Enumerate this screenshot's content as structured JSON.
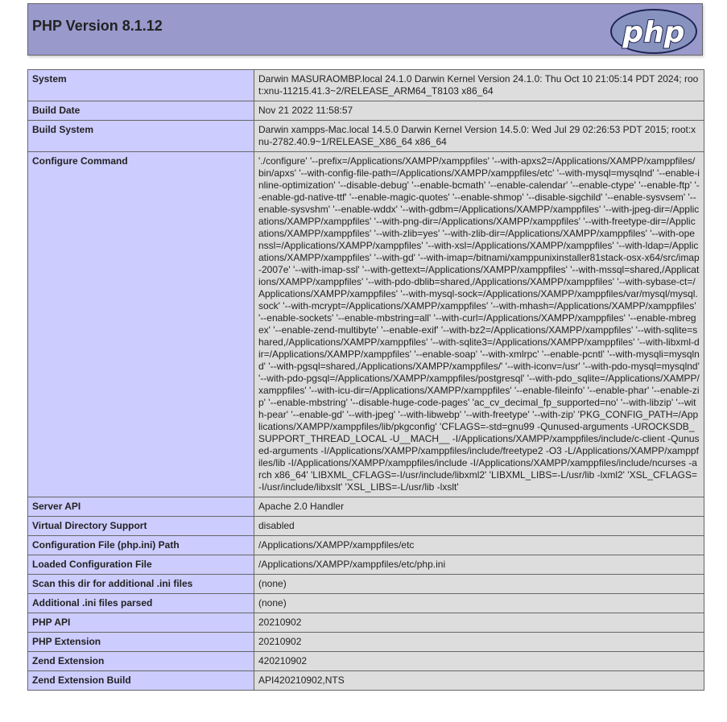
{
  "header": {
    "title": "PHP Version 8.1.12",
    "logo_text": "php",
    "logo_color": "#8892bf"
  },
  "info_rows": [
    {
      "key": "System",
      "value": "Darwin MASURAOMBP.local 24.1.0 Darwin Kernel Version 24.1.0: Thu Oct 10 21:05:14 PDT 2024; root:xnu-11215.41.3~2/RELEASE_ARM64_T8103 x86_64"
    },
    {
      "key": "Build Date",
      "value": "Nov 21 2022 11:58:57"
    },
    {
      "key": "Build System",
      "value": "Darwin xampps-Mac.local 14.5.0 Darwin Kernel Version 14.5.0: Wed Jul 29 02:26:53 PDT 2015; root:xnu-2782.40.9~1/RELEASE_X86_64 x86_64"
    },
    {
      "key": "Configure Command",
      "value": "'./configure' '--prefix=/Applications/XAMPP/xamppfiles' '--with-apxs2=/Applications/XAMPP/xamppfiles/bin/apxs' '--with-config-file-path=/Applications/XAMPP/xamppfiles/etc' '--with-mysql=mysqlnd' '--enable-inline-optimization' '--disable-debug' '--enable-bcmath' '--enable-calendar' '--enable-ctype' '--enable-ftp' '--enable-gd-native-ttf' '--enable-magic-quotes' '--enable-shmop' '--disable-sigchild' '--enable-sysvsem' '--enable-sysvshm' '--enable-wddx' '--with-gdbm=/Applications/XAMPP/xamppfiles' '--with-jpeg-dir=/Applications/XAMPP/xamppfiles' '--with-png-dir=/Applications/XAMPP/xamppfiles' '--with-freetype-dir=/Applications/XAMPP/xamppfiles' '--with-zlib=yes' '--with-zlib-dir=/Applications/XAMPP/xamppfiles' '--with-openssl=/Applications/XAMPP/xamppfiles' '--with-xsl=/Applications/XAMPP/xamppfiles' '--with-ldap=/Applications/XAMPP/xamppfiles' '--with-gd' '--with-imap=/bitnami/xamppunixinstaller81stack-osx-x64/src/imap-2007e' '--with-imap-ssl' '--with-gettext=/Applications/XAMPP/xamppfiles' '--with-mssql=shared,/Applications/XAMPP/xamppfiles' '--with-pdo-dblib=shared,/Applications/XAMPP/xamppfiles' '--with-sybase-ct=/Applications/XAMPP/xamppfiles' '--with-mysql-sock=/Applications/XAMPP/xamppfiles/var/mysql/mysql.sock' '--with-mcrypt=/Applications/XAMPP/xamppfiles' '--with-mhash=/Applications/XAMPP/xamppfiles' '--enable-sockets' '--enable-mbstring=all' '--with-curl=/Applications/XAMPP/xamppfiles' '--enable-mbregex' '--enable-zend-multibyte' '--enable-exif' '--with-bz2=/Applications/XAMPP/xamppfiles' '--with-sqlite=shared,/Applications/XAMPP/xamppfiles' '--with-sqlite3=/Applications/XAMPP/xamppfiles' '--with-libxml-dir=/Applications/XAMPP/xamppfiles' '--enable-soap' '--with-xmlrpc' '--enable-pcntl' '--with-mysqli=mysqlnd' '--with-pgsql=shared,/Applications/XAMPP/xamppfiles/' '--with-iconv=/usr' '--with-pdo-mysql=mysqlnd' '--with-pdo-pgsql=/Applications/XAMPP/xamppfiles/postgresql' '--with-pdo_sqlite=/Applications/XAMPP/xamppfiles' '--with-icu-dir=/Applications/XAMPP/xamppfiles' '--enable-fileinfo' '--enable-phar' '--enable-zip' '--enable-mbstring' '--disable-huge-code-pages' 'ac_cv_decimal_fp_supported=no' '--with-libzip' '--with-pear' '--enable-gd' '--with-jpeg' '--with-libwebp' '--with-freetype' '--with-zip' 'PKG_CONFIG_PATH=/Applications/XAMPP/xamppfiles/lib/pkgconfig' 'CFLAGS=-std=gnu99 -Qunused-arguments -UROCKSDB_SUPPORT_THREAD_LOCAL -U__MACH__ -I/Applications/XAMPP/xamppfiles/include/c-client -Qunused-arguments -I/Applications/XAMPP/xamppfiles/include/freetype2 -O3 -L/Applications/XAMPP/xamppfiles/lib -I/Applications/XAMPP/xamppfiles/include -I/Applications/XAMPP/xamppfiles/include/ncurses -arch x86_64' 'LIBXML_CFLAGS=-I/usr/include/libxml2' 'LIBXML_LIBS=-L/usr/lib -lxml2' 'XSL_CFLAGS=-I/usr/include/libxslt' 'XSL_LIBS=-L/usr/lib -lxslt'"
    },
    {
      "key": "Server API",
      "value": "Apache 2.0 Handler"
    },
    {
      "key": "Virtual Directory Support",
      "value": "disabled"
    },
    {
      "key": "Configuration File (php.ini) Path",
      "value": "/Applications/XAMPP/xamppfiles/etc"
    },
    {
      "key": "Loaded Configuration File",
      "value": "/Applications/XAMPP/xamppfiles/etc/php.ini"
    },
    {
      "key": "Scan this dir for additional .ini files",
      "value": "(none)"
    },
    {
      "key": "Additional .ini files parsed",
      "value": "(none)"
    },
    {
      "key": "PHP API",
      "value": "20210902"
    },
    {
      "key": "PHP Extension",
      "value": "20210902"
    },
    {
      "key": "Zend Extension",
      "value": "420210902"
    },
    {
      "key": "Zend Extension Build",
      "value": "API420210902,NTS"
    }
  ]
}
